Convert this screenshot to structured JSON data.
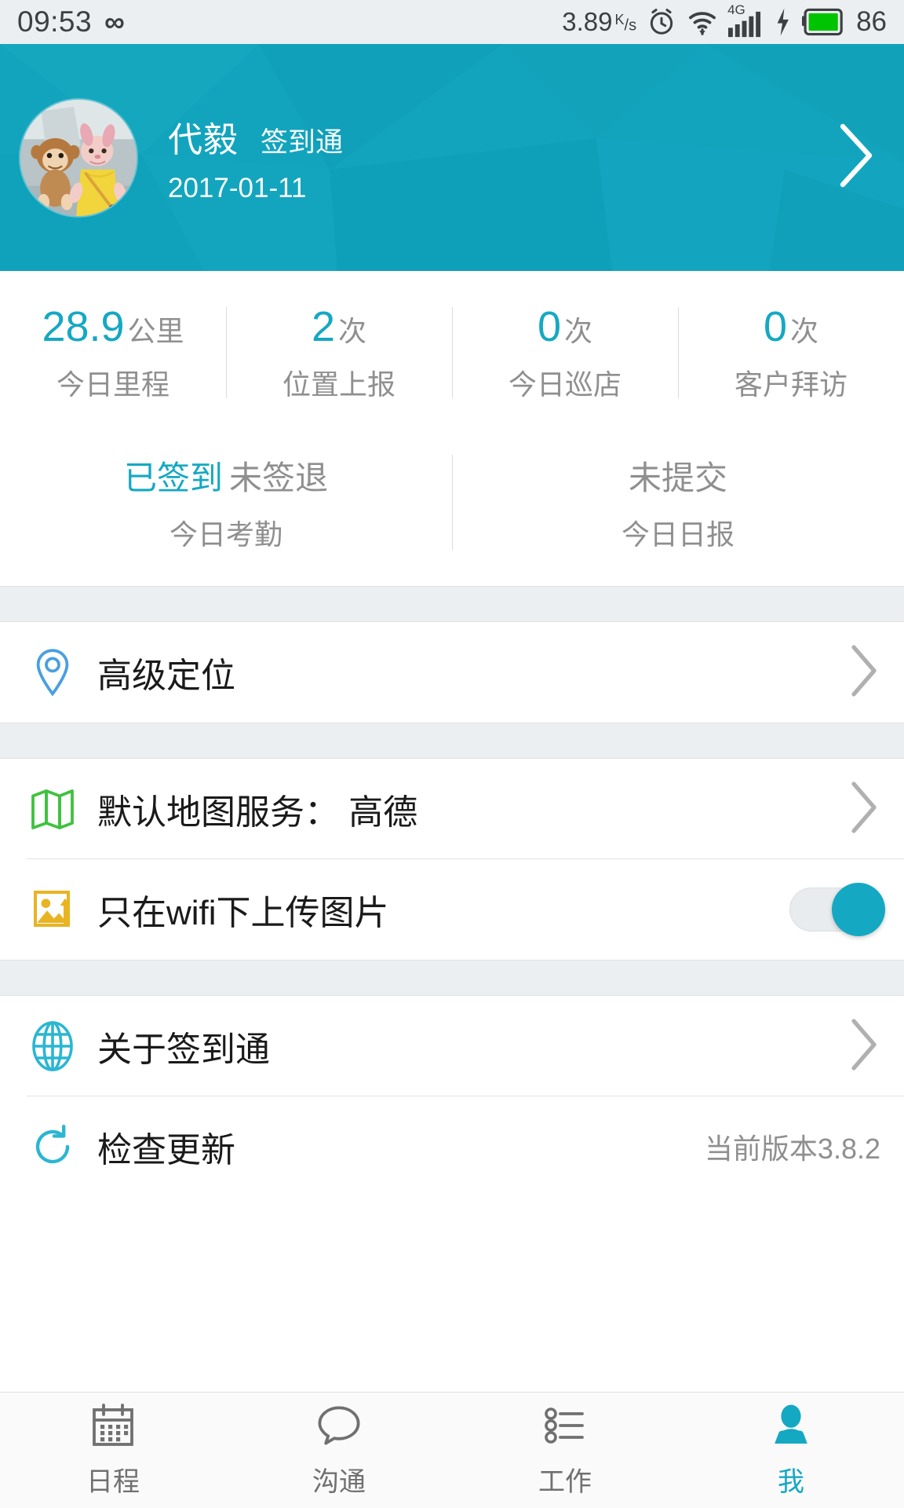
{
  "statusbar": {
    "time": "09:53",
    "infinity_icon": "infinity-icon",
    "net_speed": "3.89",
    "net_speed_unit_num": "K",
    "net_speed_unit_den": "s",
    "alarm_icon": "alarm-icon",
    "wifi_icon": "wifi-icon",
    "network_type": "4G",
    "signal_icon": "signal-bars-icon",
    "charging_icon": "charging-bolt-icon",
    "battery_icon": "battery-icon",
    "battery_level": "86"
  },
  "header": {
    "avatar": "user-avatar-plush-toys",
    "name": "代毅",
    "app_name": "签到通",
    "date": "2017-01-11",
    "chevron": "chevron-right-icon"
  },
  "stats": [
    {
      "value": "28.9",
      "unit": "公里",
      "label": "今日里程"
    },
    {
      "value": "2",
      "unit": "次",
      "label": "位置上报"
    },
    {
      "value": "0",
      "unit": "次",
      "label": "今日巡店"
    },
    {
      "value": "0",
      "unit": "次",
      "label": "客户拜访"
    }
  ],
  "attendance": [
    {
      "status_on": "已签到",
      "status_off": "未签退",
      "label": "今日考勤"
    },
    {
      "status_on": "",
      "status_off": "未提交",
      "label": "今日日报"
    }
  ],
  "settings": {
    "group1": [
      {
        "icon": "location-pin-icon",
        "label": "高级定位",
        "value": "",
        "control": "chevron"
      }
    ],
    "group2": [
      {
        "icon": "map-icon",
        "label": "默认地图服务： 高德",
        "value": "",
        "control": "chevron"
      },
      {
        "icon": "image-upload-icon",
        "label": "只在wifi下上传图片",
        "value": "",
        "control": "toggle",
        "toggle_on": true
      }
    ],
    "group3": [
      {
        "icon": "globe-icon",
        "label": "关于签到通",
        "value": "",
        "control": "chevron"
      },
      {
        "icon": "refresh-icon",
        "label": "检查更新",
        "value": "当前版本3.8.2",
        "control": "none"
      }
    ]
  },
  "tabbar": [
    {
      "icon": "calendar-icon",
      "label": "日程",
      "active": false
    },
    {
      "icon": "chat-bubble-icon",
      "label": "沟通",
      "active": false
    },
    {
      "icon": "task-list-icon",
      "label": "工作",
      "active": false
    },
    {
      "icon": "person-icon",
      "label": "我",
      "active": true
    }
  ],
  "colors": {
    "accent": "#15a8c3",
    "header_bg": "#12a4bd",
    "pin_blue": "#4a9fe0",
    "map_green": "#3fc23f",
    "image_yellow": "#e8b422",
    "battery_green": "#00c400"
  }
}
